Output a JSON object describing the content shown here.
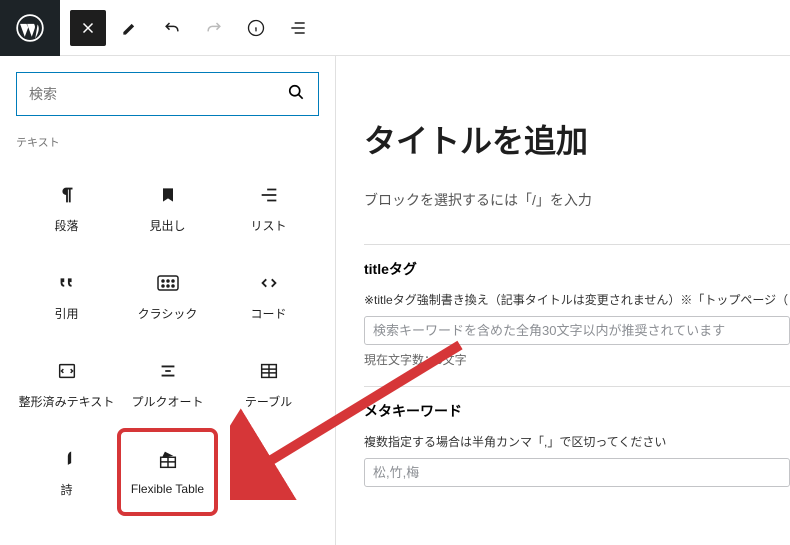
{
  "topbar": {
    "logo": "wordpress-logo"
  },
  "inserter": {
    "search_placeholder": "検索",
    "section_label": "テキスト",
    "blocks": [
      {
        "label": "段落",
        "icon": "paragraph-icon"
      },
      {
        "label": "見出し",
        "icon": "heading-icon"
      },
      {
        "label": "リスト",
        "icon": "list-icon"
      },
      {
        "label": "引用",
        "icon": "quote-icon"
      },
      {
        "label": "クラシック",
        "icon": "classic-icon"
      },
      {
        "label": "コード",
        "icon": "code-icon"
      },
      {
        "label": "整形済みテキスト",
        "icon": "preformatted-icon"
      },
      {
        "label": "プルクオート",
        "icon": "pullquote-icon"
      },
      {
        "label": "テーブル",
        "icon": "table-icon"
      },
      {
        "label": "詩",
        "icon": "verse-icon"
      },
      {
        "label": "Flexible Table",
        "icon": "flexible-table-icon",
        "highlight": true
      }
    ]
  },
  "content": {
    "title_placeholder": "タイトルを追加",
    "block_hint": "ブロックを選択するには「/」を入力",
    "meta1": {
      "title": "titleタグ",
      "desc": "※titleタグ強制書き換え（記事タイトルは変更されません）※「トップページ（",
      "placeholder": "検索キーワードを含めた全角30文字以内が推奨されています",
      "count": "現在文字数：0文字"
    },
    "meta2": {
      "title": "メタキーワード",
      "desc": "複数指定する場合は半角カンマ「,」で区切ってください",
      "placeholder": "松,竹,梅"
    }
  }
}
